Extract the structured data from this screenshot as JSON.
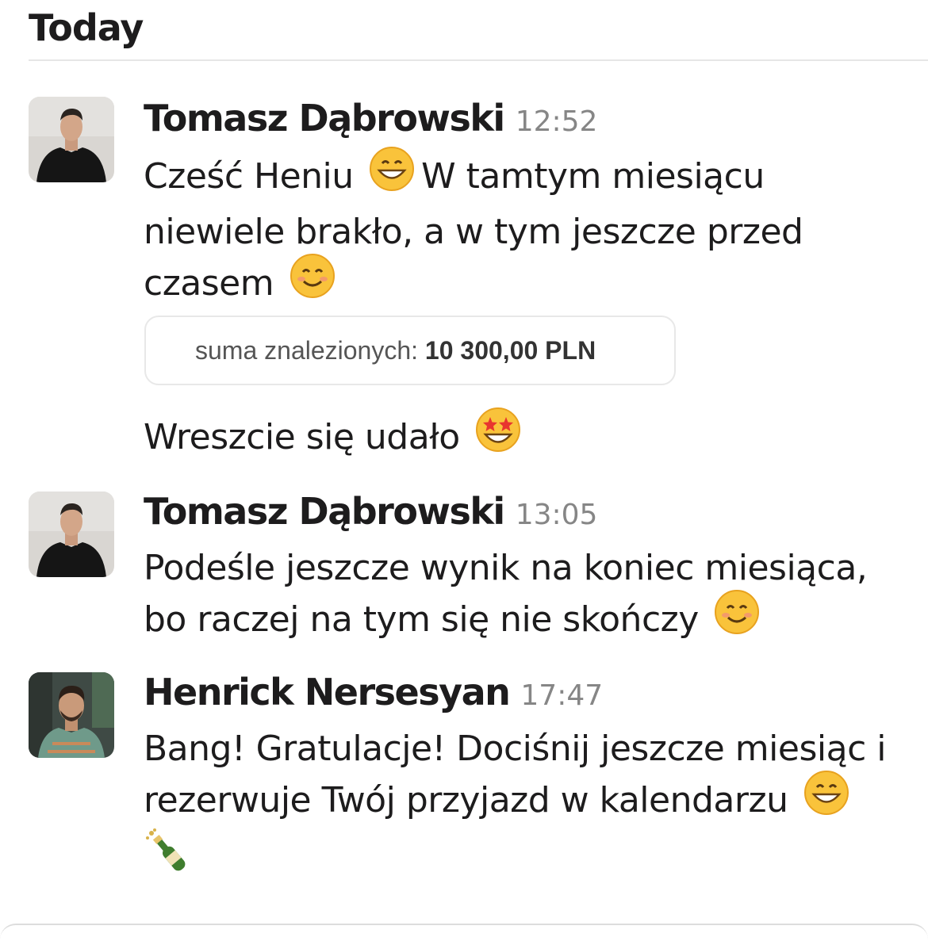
{
  "day_label": "Today",
  "messages": [
    {
      "author": "Tomasz Dąbrowski",
      "time": "12:52",
      "lines": [
        "Cześć Heniu",
        "W tamtym miesiącu",
        "niewiele brakło, a w tym jeszcze przed",
        "czasem"
      ],
      "attachment": {
        "label": "suma znalezionych:",
        "value": "10 300,00 PLN"
      },
      "followup": "Wreszcie się udało"
    },
    {
      "author": "Tomasz Dąbrowski",
      "time": "13:05",
      "lines": [
        "Podeśle jeszcze wynik na koniec miesiąca,",
        "bo raczej na tym się nie skończy"
      ]
    },
    {
      "author": "Henrick Nersesyan",
      "time": "17:47",
      "lines": [
        "Bang! Gratulacje! Dociśnij jeszcze miesiąc i",
        "rezerwuje Twój przyjazd w kalendarzu"
      ]
    }
  ],
  "icons": {
    "grin": "grinning-face-icon",
    "smile": "smiling-face-icon",
    "star_struck": "star-struck-icon",
    "champagne": "champagne-bottle-icon"
  }
}
